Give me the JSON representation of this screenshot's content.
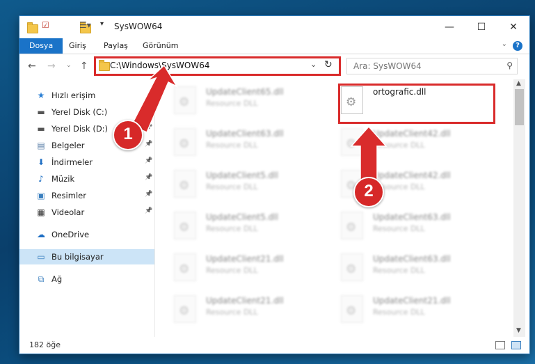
{
  "window": {
    "title": "SysWOW64",
    "controls": {
      "minimize": "—",
      "maximize": "☐",
      "close": "✕"
    }
  },
  "ribbon": {
    "tabs": [
      {
        "label": "Dosya",
        "active": true
      },
      {
        "label": "Giriş"
      },
      {
        "label": "Paylaş"
      },
      {
        "label": "Görünüm"
      }
    ],
    "help": "?"
  },
  "nav": {
    "address": "C:\\Windows\\SysWOW64",
    "search_placeholder": "Ara: SysWOW64"
  },
  "sidebar": {
    "items": [
      {
        "label": "Hızlı erişim",
        "icon": "star-icon",
        "glyph": "★",
        "color": "#2a7fd4"
      },
      {
        "label": "Yerel Disk (C:)",
        "icon": "disk-icon",
        "glyph": "▬",
        "color": "#555555",
        "pinned": true
      },
      {
        "label": "Yerel Disk (D:)",
        "icon": "disk-icon",
        "glyph": "▬",
        "color": "#555555",
        "pinned": true
      },
      {
        "label": "Belgeler",
        "icon": "documents-icon",
        "glyph": "▤",
        "color": "#5b7fa8",
        "pinned": true
      },
      {
        "label": "İndirmeler",
        "icon": "download-icon",
        "glyph": "⬇",
        "color": "#1f6fc4",
        "pinned": true
      },
      {
        "label": "Müzik",
        "icon": "music-icon",
        "glyph": "♪",
        "color": "#1f6fc4",
        "pinned": true
      },
      {
        "label": "Resimler",
        "icon": "pictures-icon",
        "glyph": "▣",
        "color": "#3a7fbf",
        "pinned": true
      },
      {
        "label": "Videolar",
        "icon": "video-icon",
        "glyph": "▦",
        "color": "#333333",
        "pinned": true
      },
      {
        "label": "OneDrive",
        "icon": "cloud-icon",
        "glyph": "☁",
        "color": "#1f6fc4"
      },
      {
        "label": "Bu bilgisayar",
        "icon": "computer-icon",
        "glyph": "▭",
        "color": "#3a7fbf",
        "selected": true
      },
      {
        "label": "Ağ",
        "icon": "network-icon",
        "glyph": "⧉",
        "color": "#3a7fbf"
      }
    ]
  },
  "files": {
    "left_column": [
      {
        "name": "UpdateClient65.dll",
        "type": "Resource DLL"
      },
      {
        "name": "UpdateClient63.dll",
        "type": "Resource DLL"
      },
      {
        "name": "UpdateClient5.dll",
        "type": "Resource DLL"
      },
      {
        "name": "UpdateClient5.dll",
        "type": "Resource DLL"
      },
      {
        "name": "UpdateClient21.dll",
        "type": "Resource DLL"
      },
      {
        "name": "UpdateClient21.dll",
        "type": "Resource DLL"
      }
    ],
    "right_column": [
      {
        "name": "ortografic.dll",
        "type": "",
        "highlighted": true
      },
      {
        "name": "UpdateClient42.dll",
        "type": "Resource DLL"
      },
      {
        "name": "UpdateClient42.dll",
        "type": "Resource DLL"
      },
      {
        "name": "UpdateClient63.dll",
        "type": "Resource DLL"
      },
      {
        "name": "UpdateClient63.dll",
        "type": "Resource DLL"
      },
      {
        "name": "UpdateClient21.dll",
        "type": "Resource DLL"
      }
    ]
  },
  "status": {
    "count": "182 öğe"
  },
  "annotations": {
    "step1": "1",
    "step2": "2",
    "color": "#d92b2b"
  }
}
